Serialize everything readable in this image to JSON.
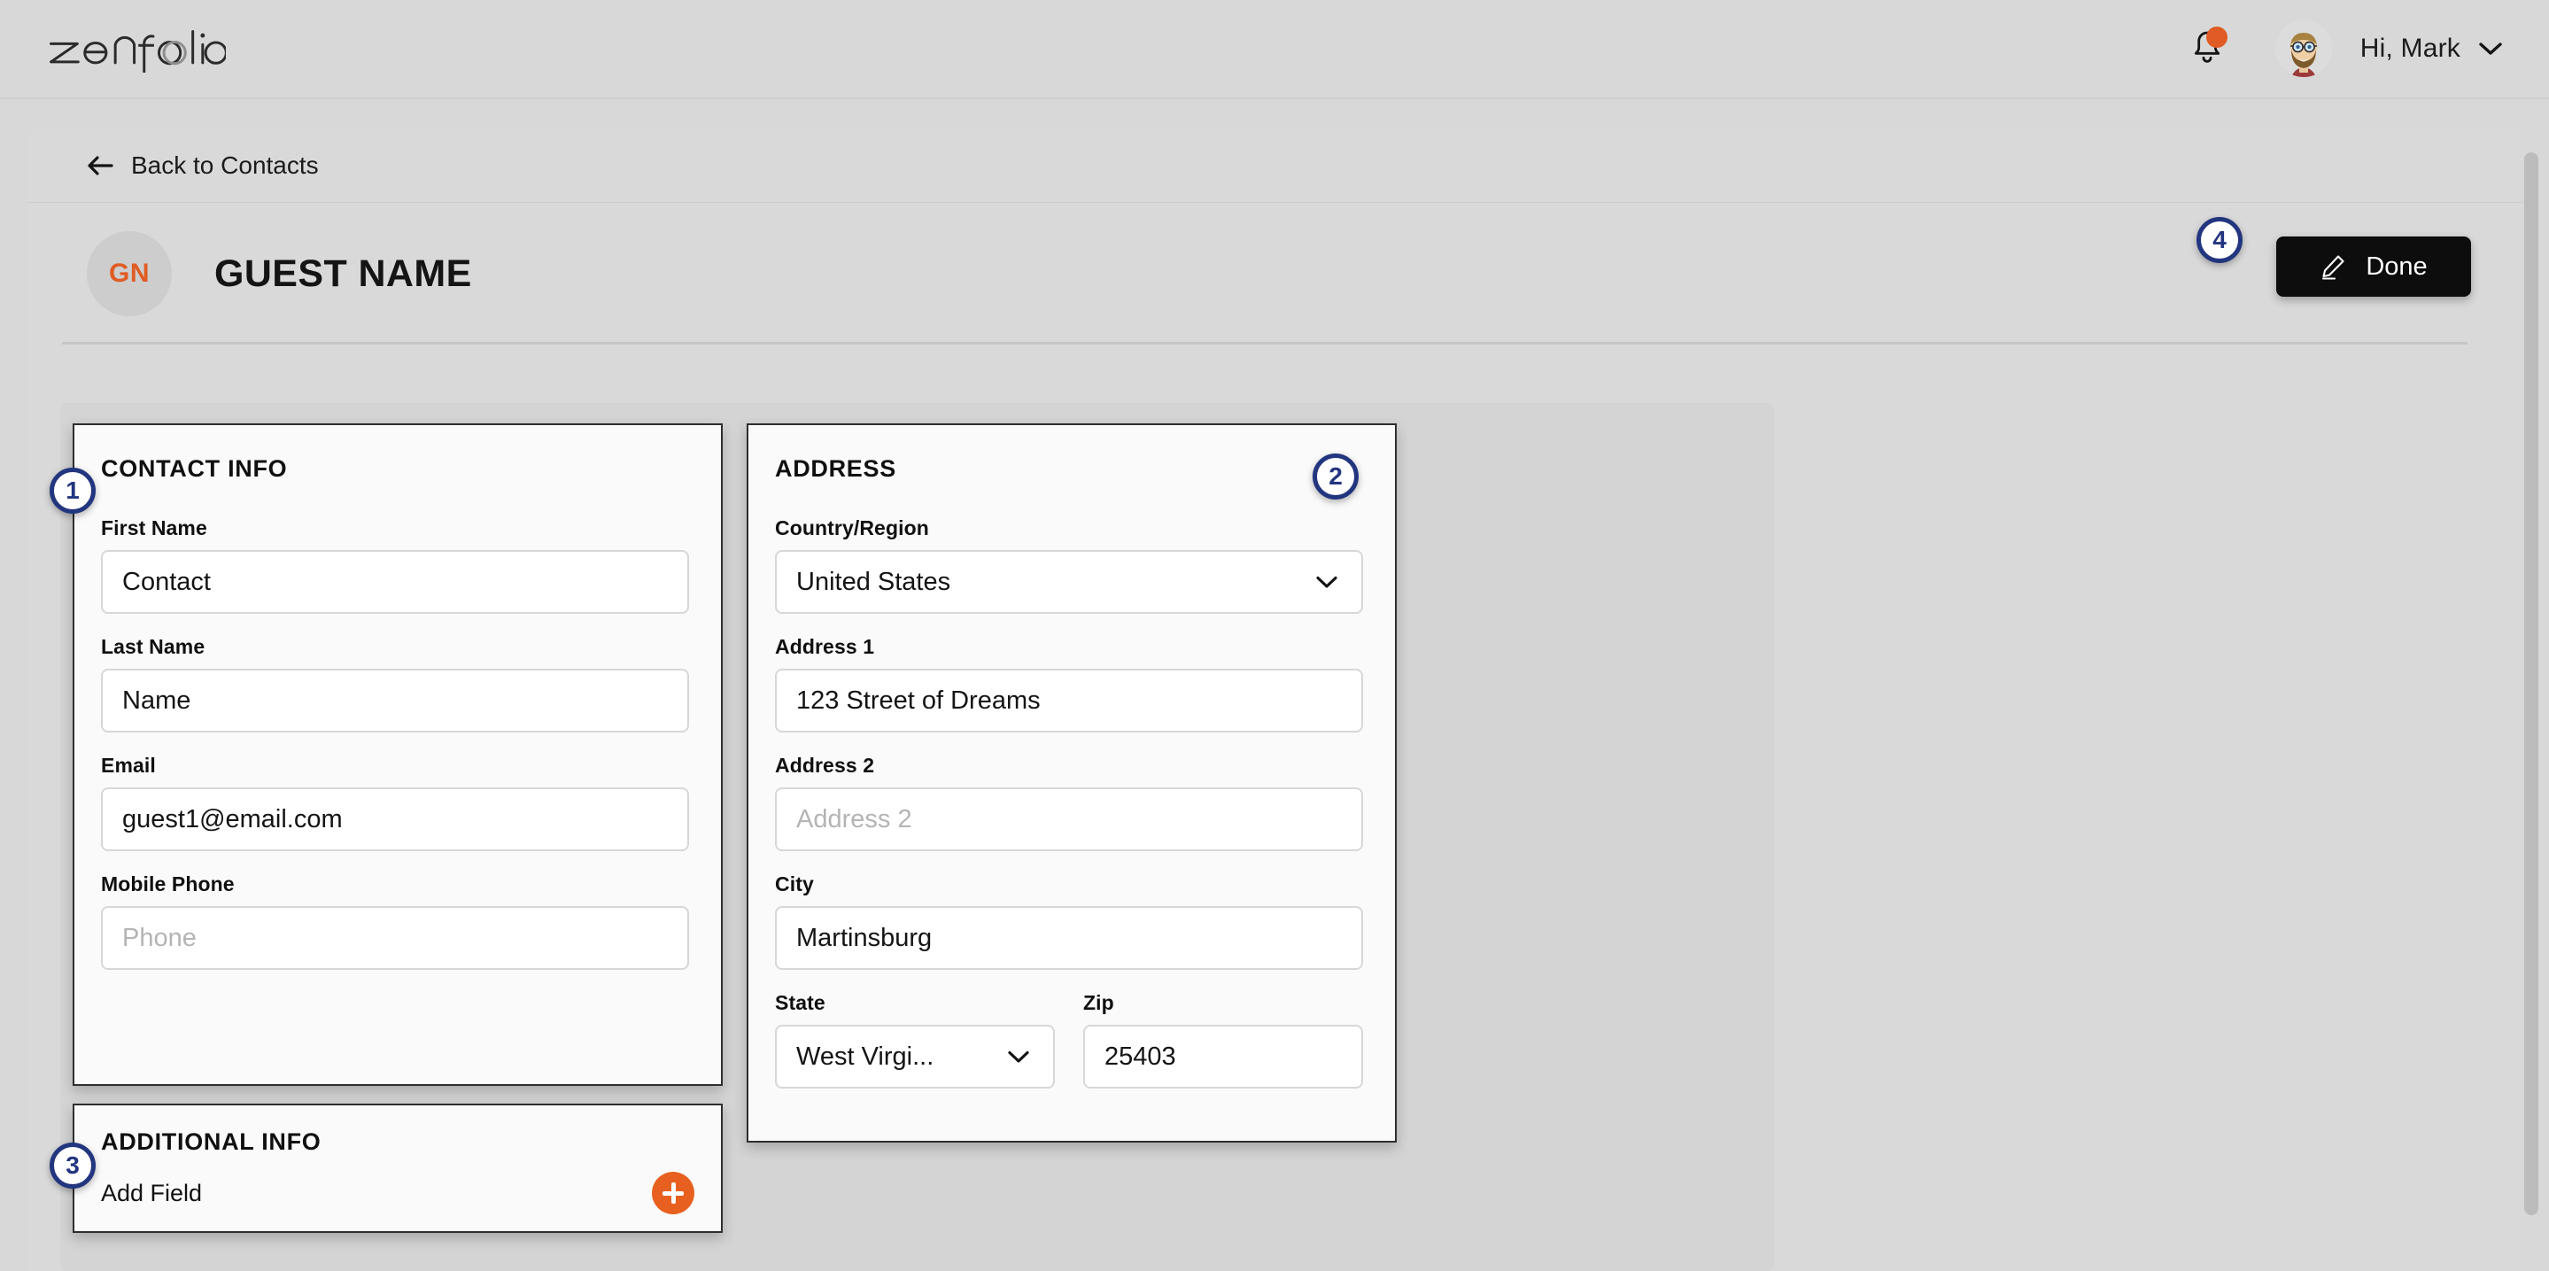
{
  "brand": {
    "logo_text": "zenfolio",
    "accent_orange": "#e05c24",
    "annotation_blue": "#22357f",
    "page_bg": "#d8d8d8"
  },
  "topbar": {
    "notifications_icon": "bell-icon",
    "has_notification_dot": true,
    "avatar_icon": "user-avatar",
    "greeting": "Hi, Mark",
    "greeting_chevron": "chevron-down-icon"
  },
  "nav": {
    "back_label": "Back to Contacts",
    "back_icon": "arrow-left-icon"
  },
  "header": {
    "initials": "GN",
    "title": "GUEST NAME",
    "done_label": "Done",
    "done_icon": "pencil-icon"
  },
  "contact_info": {
    "title": "CONTACT INFO",
    "fields": [
      {
        "label": "First Name",
        "value": "Contact",
        "placeholder": "First Name",
        "is_placeholder": false,
        "type": "text"
      },
      {
        "label": "Last Name",
        "value": "Name",
        "placeholder": "Last Name",
        "is_placeholder": false,
        "type": "text"
      },
      {
        "label": "Email",
        "value": "guest1@email.com",
        "placeholder": "Email",
        "is_placeholder": false,
        "type": "text"
      },
      {
        "label": "Mobile Phone",
        "value": "Phone",
        "placeholder": "Phone",
        "is_placeholder": true,
        "type": "text"
      }
    ]
  },
  "address": {
    "title": "ADDRESS",
    "fields": [
      {
        "label": "Country/Region",
        "value": "United States",
        "placeholder": "Country/Region",
        "is_placeholder": false,
        "type": "select"
      },
      {
        "label": "Address 1",
        "value": "123 Street of Dreams",
        "placeholder": "Address 1",
        "is_placeholder": false,
        "type": "text"
      },
      {
        "label": "Address 2",
        "value": "Address 2",
        "placeholder": "Address 2",
        "is_placeholder": true,
        "type": "text"
      },
      {
        "label": "City",
        "value": "Martinsburg",
        "placeholder": "City",
        "is_placeholder": false,
        "type": "text"
      }
    ],
    "state": {
      "label": "State",
      "value": "West Virgi...",
      "type": "select"
    },
    "zip": {
      "label": "Zip",
      "value": "25403",
      "type": "text"
    }
  },
  "additional_info": {
    "title": "ADDITIONAL INFO",
    "add_field_label": "Add Field",
    "add_icon": "plus-icon"
  },
  "annotations": [
    {
      "id": "1",
      "target": "contact-info-panel"
    },
    {
      "id": "2",
      "target": "address-panel"
    },
    {
      "id": "3",
      "target": "additional-info-panel"
    },
    {
      "id": "4",
      "target": "done-button"
    }
  ]
}
